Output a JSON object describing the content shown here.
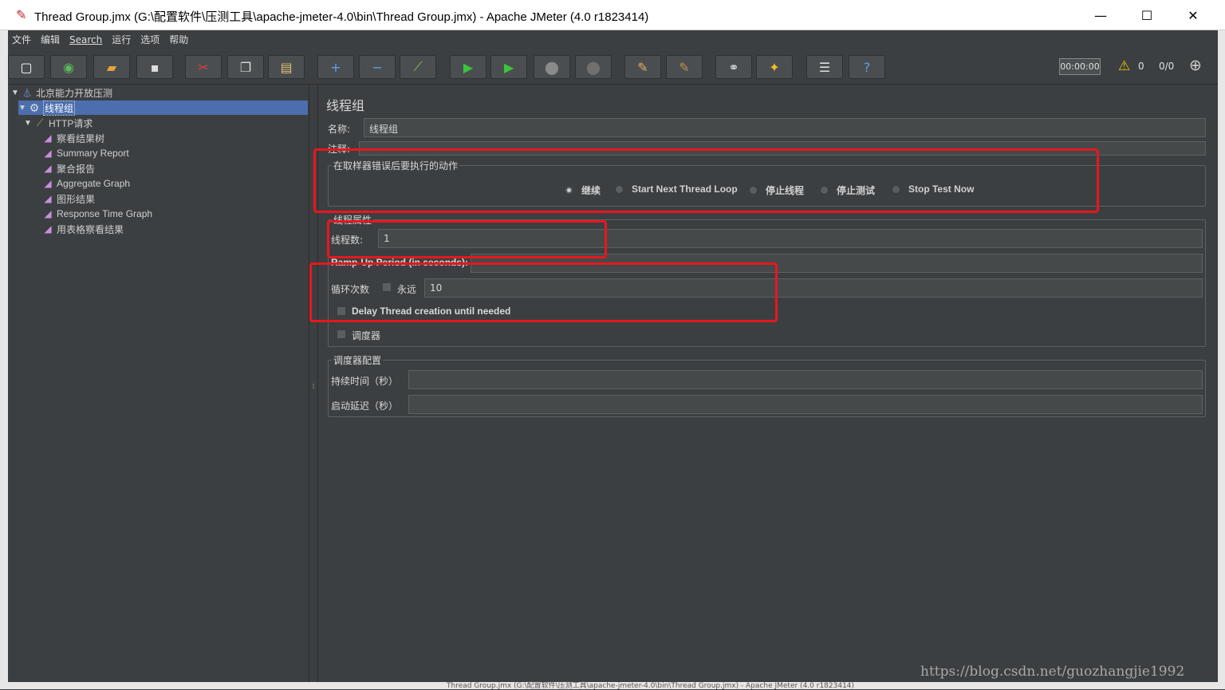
{
  "window": {
    "title": "Thread Group.jmx (G:\\配置软件\\压测工具\\apache-jmeter-4.0\\bin\\Thread Group.jmx) - Apache JMeter (4.0 r1823414)",
    "minimize": "—",
    "maximize": "☐",
    "close": "✕"
  },
  "menu": [
    "文件",
    "编辑",
    "Search",
    "运行",
    "选项",
    "帮助"
  ],
  "toolbar": {
    "buttons": [
      {
        "name": "new-icon",
        "glyph": "▢",
        "color": "#ffffff"
      },
      {
        "name": "templates-icon",
        "glyph": "◉",
        "color": "#5cb85c"
      },
      {
        "name": "open-icon",
        "glyph": "▰",
        "color": "#e8a33c"
      },
      {
        "name": "save-icon",
        "glyph": "▪",
        "color": "#dddddd"
      },
      {
        "name": "cut-icon",
        "glyph": "✂",
        "color": "#e04040"
      },
      {
        "name": "copy-icon",
        "glyph": "❐",
        "color": "#dddddd"
      },
      {
        "name": "paste-icon",
        "glyph": "▤",
        "color": "#e0c070"
      },
      {
        "name": "expand-icon",
        "glyph": "+",
        "color": "#5aa0e8"
      },
      {
        "name": "collapse-icon",
        "glyph": "−",
        "color": "#5aa0e8"
      },
      {
        "name": "toggle-icon",
        "glyph": "⟋",
        "color": "#8bc34a"
      },
      {
        "name": "start-icon",
        "glyph": "▶",
        "color": "#3cc43c"
      },
      {
        "name": "start-no-pause-icon",
        "glyph": "▶",
        "color": "#3cc43c"
      },
      {
        "name": "stop-icon",
        "glyph": "⬤",
        "color": "#8a8a8a"
      },
      {
        "name": "shutdown-icon",
        "glyph": "⬤",
        "color": "#707070"
      },
      {
        "name": "clear-icon",
        "glyph": "✎",
        "color": "#e0b060"
      },
      {
        "name": "clear-all-icon",
        "glyph": "✎",
        "color": "#c09050"
      },
      {
        "name": "search-icon",
        "glyph": "⚭",
        "color": "#dddddd"
      },
      {
        "name": "reset-search-icon",
        "glyph": "✦",
        "color": "#f0c020"
      },
      {
        "name": "function-helper-icon",
        "glyph": "☰",
        "color": "#dddddd"
      },
      {
        "name": "help-icon",
        "glyph": "?",
        "color": "#5aa0e8"
      }
    ],
    "timer": "00:00:00",
    "warning_count": "0",
    "threads_ratio": "0/0"
  },
  "tree": {
    "root": "北京能力开放压测",
    "thread_group": "线程组",
    "http_request": "HTTP请求",
    "listeners": [
      "察看结果树",
      "Summary Report",
      "聚合报告",
      "Aggregate Graph",
      "图形结果",
      "Response Time Graph",
      "用表格察看结果"
    ]
  },
  "panel": {
    "title": "线程组",
    "name_label": "名称:",
    "name_value": "线程组",
    "comment_label": "注释:",
    "error_action": {
      "legend": "在取样器错误后要执行的动作",
      "options": [
        "继续",
        "Start Next Thread Loop",
        "停止线程",
        "停止测试",
        "Stop Test Now"
      ],
      "selected": "继续"
    },
    "thread_props": {
      "legend": "线程属性",
      "threads_label": "线程数:",
      "threads_value": "1",
      "rampup_label": "Ramp-Up Period (in seconds):",
      "rampup_value": "",
      "loop_label": "循环次数",
      "forever_label": "永远",
      "loop_value": "10",
      "delay_label": "Delay Thread creation until needed",
      "scheduler_label": "调度器"
    },
    "scheduler_config": {
      "legend": "调度器配置",
      "duration_label": "持续时间（秒）",
      "startup_delay_label": "启动延迟（秒）"
    }
  },
  "watermark": "https://blog.csdn.net/guozhangjie1992",
  "taskbar_text": "Thread Group.jmx (G:\\配置软件\\压测工具\\apache-jmeter-4.0\\bin\\Thread Group.jmx) - Apache JMeter (4.0 r1823414)"
}
